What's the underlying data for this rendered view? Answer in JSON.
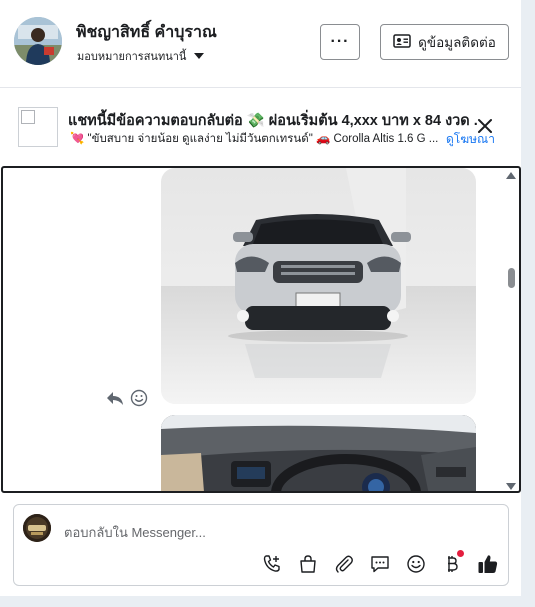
{
  "header": {
    "name": "พิชญาสิทธิ์ คำบุราณ",
    "subtitle": "มอบหมายการสนทนานี้",
    "more_label": "···",
    "contact_label": "ดูข้อมูลติดต่อ"
  },
  "banner": {
    "title": "แชทนี้มีข้อความตอบกลับต่อ 💸 ผ่อนเริ่มต้น 4,xxx บาท x 84 งวด .",
    "subtitle": "💘 \"ขับสบาย จ่ายน้อย ดูแลง่าย ไม่มีวันตกเทรนด์\" 🚗 Corolla Altis 1.6 G ...",
    "link": "ดูโฆษณา"
  },
  "thread": {
    "photo1": "car-front-photo",
    "photo2": "car-interior-photo"
  },
  "composer": {
    "placeholder": "ตอบกลับใน Messenger...",
    "accent": "#1877f2"
  },
  "colors": {
    "brand_blue": "#1877f2",
    "notification_red": "#e41e3f"
  }
}
